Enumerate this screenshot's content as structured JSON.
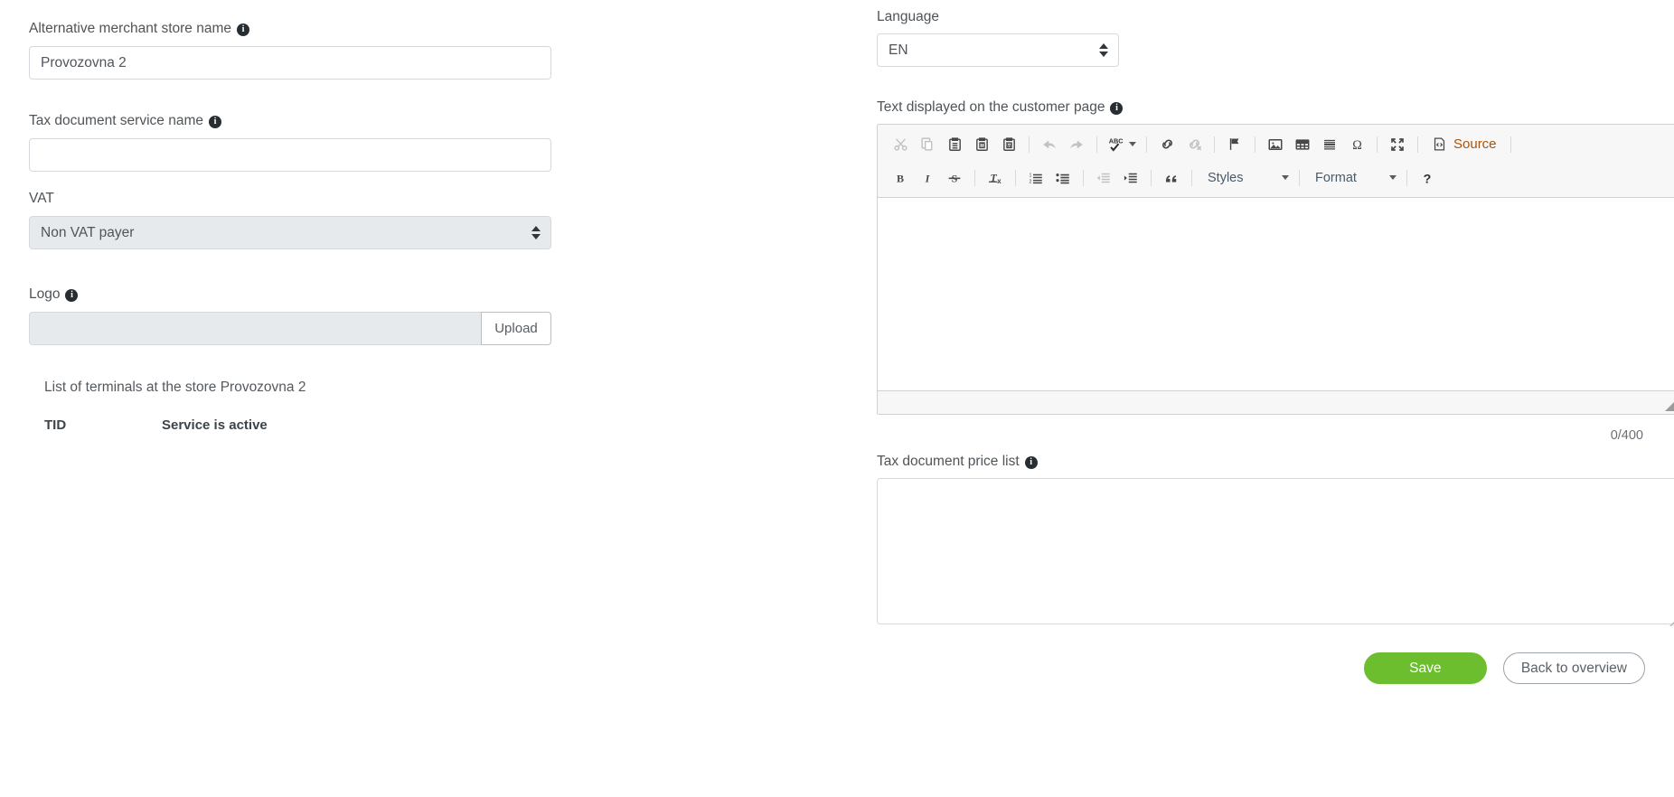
{
  "colors": {
    "save_green": "#6cbe2f",
    "source_label": "#a8540d",
    "input_border": "#d5d9dd",
    "disabled_field": "#e6eaed",
    "toolbar_bg": "#f7f7f7"
  },
  "left": {
    "alt_store_name": {
      "label": "Alternative merchant store name",
      "value": "Provozovna 2",
      "info": "info-icon"
    },
    "tax_document_service_name": {
      "label": "Tax document service name",
      "value": "",
      "placeholder": "",
      "info": "info-icon"
    },
    "vat": {
      "label": "VAT",
      "value": "Non VAT payer"
    },
    "logo": {
      "label": "Logo",
      "value": "",
      "upload_label": "Upload",
      "info": "info-icon"
    },
    "terminals": {
      "title": "List of terminals at the store Provozovna 2",
      "columns": [
        "TID",
        "Service is active"
      ],
      "rows": []
    }
  },
  "right": {
    "language": {
      "label": "Language",
      "value": "EN"
    },
    "customer_page_text": {
      "label": "Text displayed on the customer page",
      "value": "",
      "counter": "0/400"
    },
    "editor": {
      "toolbar_row1": [
        {
          "name": "cut-icon",
          "title": "Cut",
          "disabled": true
        },
        {
          "name": "copy-icon",
          "title": "Copy",
          "disabled": true
        },
        {
          "name": "paste-icon",
          "title": "Paste",
          "disabled": false
        },
        {
          "name": "paste-text-icon",
          "title": "Paste as plain text",
          "disabled": false
        },
        {
          "name": "paste-word-icon",
          "title": "Paste from Word",
          "disabled": false
        },
        {
          "name": "undo-icon",
          "title": "Undo",
          "disabled": true
        },
        {
          "name": "redo-icon",
          "title": "Redo",
          "disabled": true
        },
        {
          "name": "spellcheck-icon",
          "title": "Spell Check As You Type",
          "disabled": false
        },
        {
          "name": "link-icon",
          "title": "Link",
          "disabled": false
        },
        {
          "name": "unlink-icon",
          "title": "Unlink",
          "disabled": true
        },
        {
          "name": "anchor-flag-icon",
          "title": "Anchor",
          "disabled": false
        },
        {
          "name": "image-icon",
          "title": "Image",
          "disabled": false
        },
        {
          "name": "table-icon",
          "title": "Table",
          "disabled": false
        },
        {
          "name": "horizontal-rule-icon",
          "title": "Horizontal Line",
          "disabled": false
        },
        {
          "name": "special-char-icon",
          "title": "Insert Special Character",
          "disabled": false
        },
        {
          "name": "maximize-icon",
          "title": "Maximize",
          "disabled": false
        }
      ],
      "source_label": "Source",
      "toolbar_row2": [
        {
          "name": "bold-icon",
          "title": "Bold",
          "disabled": false
        },
        {
          "name": "italic-icon",
          "title": "Italic",
          "disabled": false
        },
        {
          "name": "strikethrough-icon",
          "title": "Strikethrough",
          "disabled": false
        },
        {
          "name": "remove-format-icon",
          "title": "Remove Format",
          "disabled": false
        },
        {
          "name": "numbered-list-icon",
          "title": "Insert/Remove Numbered List",
          "disabled": false
        },
        {
          "name": "bulleted-list-icon",
          "title": "Insert/Remove Bulleted List",
          "disabled": false
        },
        {
          "name": "outdent-icon",
          "title": "Decrease Indent",
          "disabled": true
        },
        {
          "name": "indent-icon",
          "title": "Increase Indent",
          "disabled": false
        },
        {
          "name": "blockquote-icon",
          "title": "Block Quote",
          "disabled": false
        }
      ],
      "styles_label": "Styles",
      "format_label": "Format",
      "help_label": "?"
    },
    "tax_document_price_list": {
      "label": "Tax document price list",
      "value": "",
      "placeholder": ""
    },
    "actions": {
      "save": "Save",
      "back": "Back to overview"
    }
  }
}
